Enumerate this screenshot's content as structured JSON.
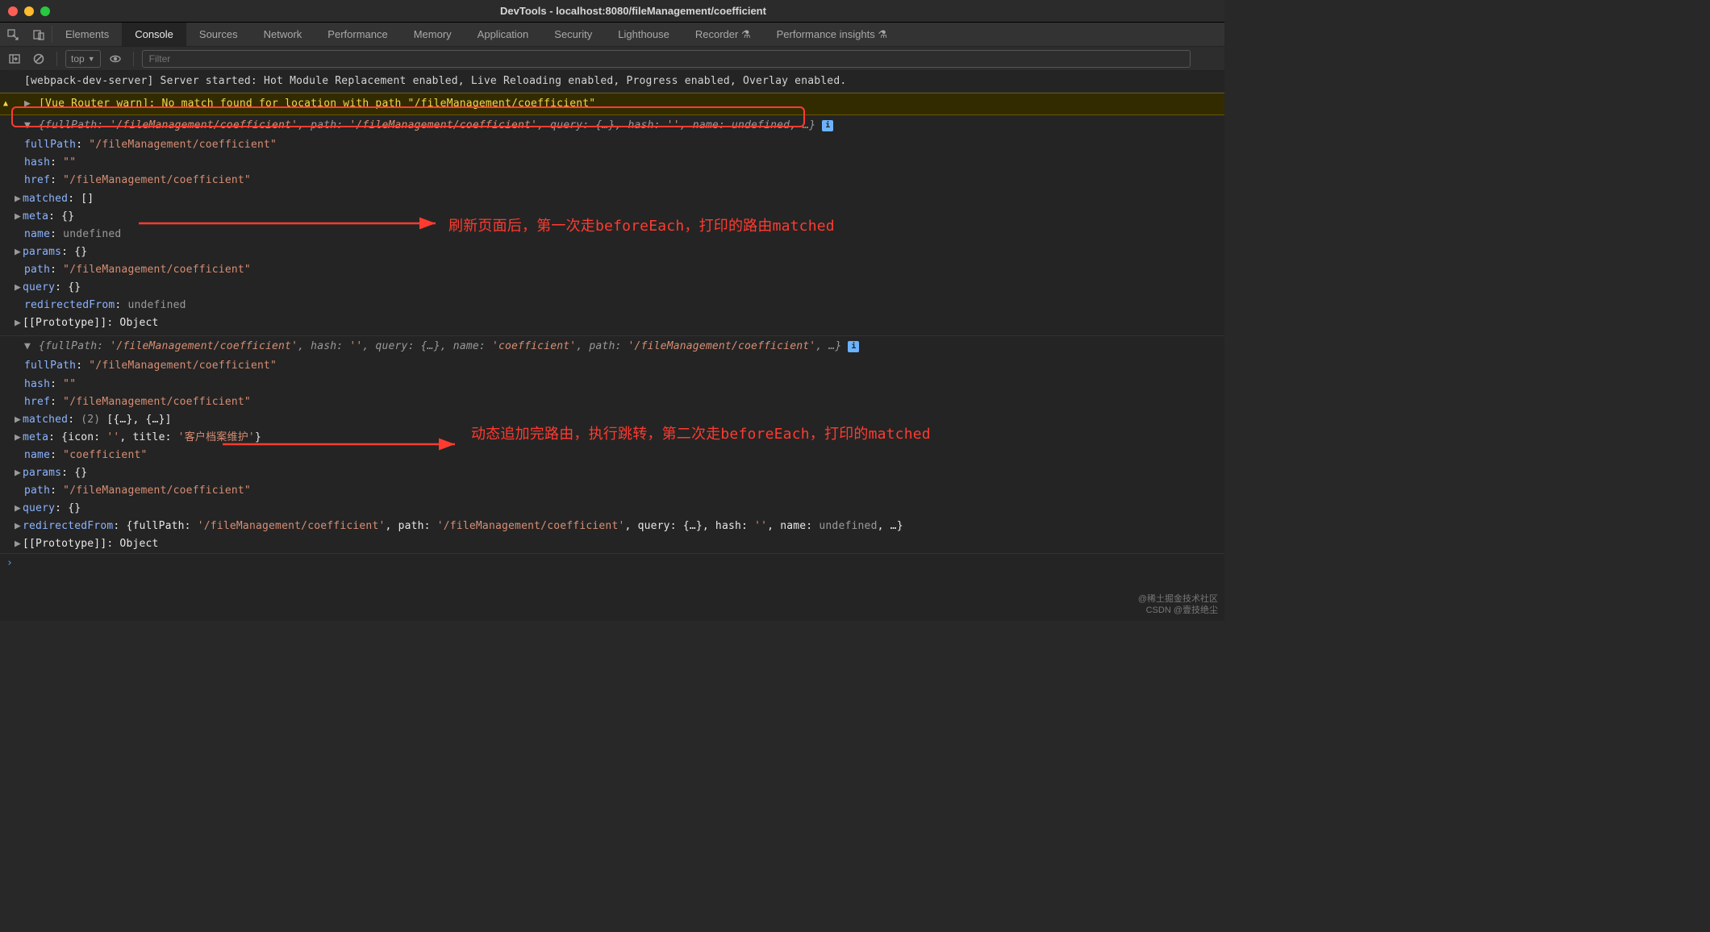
{
  "titlebar": {
    "title": "DevTools - localhost:8080/fileManagement/coefficient"
  },
  "tabs": {
    "items": [
      "Elements",
      "Console",
      "Sources",
      "Network",
      "Performance",
      "Memory",
      "Application",
      "Security",
      "Lighthouse",
      "Recorder ⚗",
      "Performance insights ⚗"
    ],
    "active_index": 1
  },
  "toolbar": {
    "context": "top",
    "filter_placeholder": "Filter"
  },
  "logs": {
    "line0": "[webpack-dev-server] Server started: Hot Module Replacement enabled, Live Reloading enabled, Progress enabled, Overlay enabled.",
    "warn": "[Vue Router warn]: No match found for location with path \"/fileManagement/coefficient\"",
    "obj1": {
      "summary_prefix": "{fullPath: ",
      "summary_path": "'/fileManagement/coefficient'",
      "summary_mid1": ", path: ",
      "summary_mid2": ", query: ",
      "summary_q": "{…}",
      "summary_mid3": ", hash: ",
      "summary_hash": "''",
      "summary_mid4": ", name: ",
      "summary_name": "undefined",
      "summary_suffix": ", …}",
      "fullPath_k": "fullPath",
      "fullPath_v": "\"/fileManagement/coefficient\"",
      "hash_k": "hash",
      "hash_v": "\"\"",
      "href_k": "href",
      "href_v": "\"/fileManagement/coefficient\"",
      "matched_k": "matched",
      "matched_v": "[]",
      "meta_k": "meta",
      "meta_v": "{}",
      "name_k": "name",
      "name_v": "undefined",
      "params_k": "params",
      "params_v": "{}",
      "path_k": "path",
      "path_v": "\"/fileManagement/coefficient\"",
      "query_k": "query",
      "query_v": "{}",
      "redirectedFrom_k": "redirectedFrom",
      "redirectedFrom_v": "undefined",
      "proto_k": "[[Prototype]]",
      "proto_v": "Object"
    },
    "obj2": {
      "summary_prefix": "{fullPath: ",
      "summary_path": "'/fileManagement/coefficient'",
      "summary_mid1": ", hash: ",
      "summary_hash": "''",
      "summary_mid2": ", query: ",
      "summary_q": "{…}",
      "summary_mid3": ", name: ",
      "summary_name": "'coefficient'",
      "summary_mid4": ", path: ",
      "summary_path2": "'/fileManagement/coefficient'",
      "summary_suffix": ", …}",
      "fullPath_k": "fullPath",
      "fullPath_v": "\"/fileManagement/coefficient\"",
      "hash_k": "hash",
      "hash_v": "\"\"",
      "href_k": "href",
      "href_v": "\"/fileManagement/coefficient\"",
      "matched_k": "matched",
      "matched_v_count": "(2)",
      "matched_v": "[{…}, {…}]",
      "meta_k": "meta",
      "meta_v_pre": "{icon: ",
      "meta_icon": "''",
      "meta_mid": ", title: ",
      "meta_title": "'客户档案维护'",
      "meta_v_suf": "}",
      "name_k": "name",
      "name_v": "\"coefficient\"",
      "params_k": "params",
      "params_v": "{}",
      "path_k": "path",
      "path_v": "\"/fileManagement/coefficient\"",
      "query_k": "query",
      "query_v": "{}",
      "redirectedFrom_k": "redirectedFrom",
      "rf_pre": "{fullPath: ",
      "rf_path": "'/fileManagement/coefficient'",
      "rf_mid1": ", path: ",
      "rf_mid2": ", query: ",
      "rf_q": "{…}",
      "rf_mid3": ", hash: ",
      "rf_hash": "''",
      "rf_mid4": ", name: ",
      "rf_name": "undefined",
      "rf_suf": ", …}",
      "proto_k": "[[Prototype]]",
      "proto_v": "Object"
    }
  },
  "annotations": {
    "a1": "刷新页面后，第一次走beforeEach，打印的路由matched",
    "a2": "动态追加完路由，执行跳转，第二次走beforeEach，打印的matched"
  },
  "watermark": {
    "l1": "@稀土掘金技术社区",
    "l2": "CSDN @壹技绝尘"
  }
}
